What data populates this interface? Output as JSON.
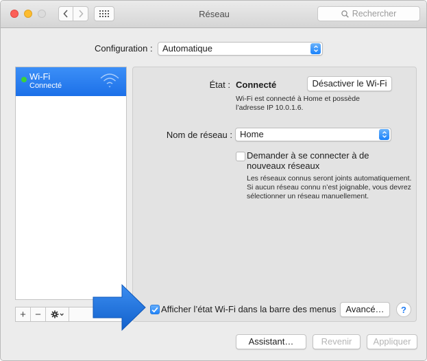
{
  "window": {
    "title": "Réseau"
  },
  "search": {
    "placeholder": "Rechercher"
  },
  "config": {
    "label": "Configuration :",
    "value": "Automatique"
  },
  "sidebar": {
    "items": [
      {
        "name": "Wi-Fi",
        "status": "Connecté",
        "status_color": "#3bd23a"
      }
    ],
    "toolbar": {
      "add": "+",
      "remove": "−"
    }
  },
  "detail": {
    "state_label": "État :",
    "state_value": "Connecté",
    "toggle_wifi_button": "Désactiver le Wi-Fi",
    "state_desc_line1": "Wi-Fi est connecté à Home et possède",
    "state_desc_line2": "l’adresse IP 10.0.1.6.",
    "network_label": "Nom de réseau :",
    "network_value": "Home",
    "ask_join_line1": "Demander à se connecter à de",
    "ask_join_line2": "nouveaux réseaux",
    "ask_join_checked": false,
    "ask_desc_line1": "Les réseaux connus seront joints automatiquement.",
    "ask_desc_line2": "Si aucun réseau connu n’est joignable, vous devrez",
    "ask_desc_line3": "sélectionner un réseau manuellement.",
    "menubar_label": "Afficher l’état Wi-Fi dans la barre des menus",
    "menubar_checked": true,
    "advanced_button": "Avancé…",
    "help": "?"
  },
  "footer": {
    "assistant_button": "Assistant…",
    "revert_button": "Revenir",
    "apply_button": "Appliquer"
  },
  "colors": {
    "accent": "#1c70e8",
    "arrow": "#1a6fd8"
  }
}
